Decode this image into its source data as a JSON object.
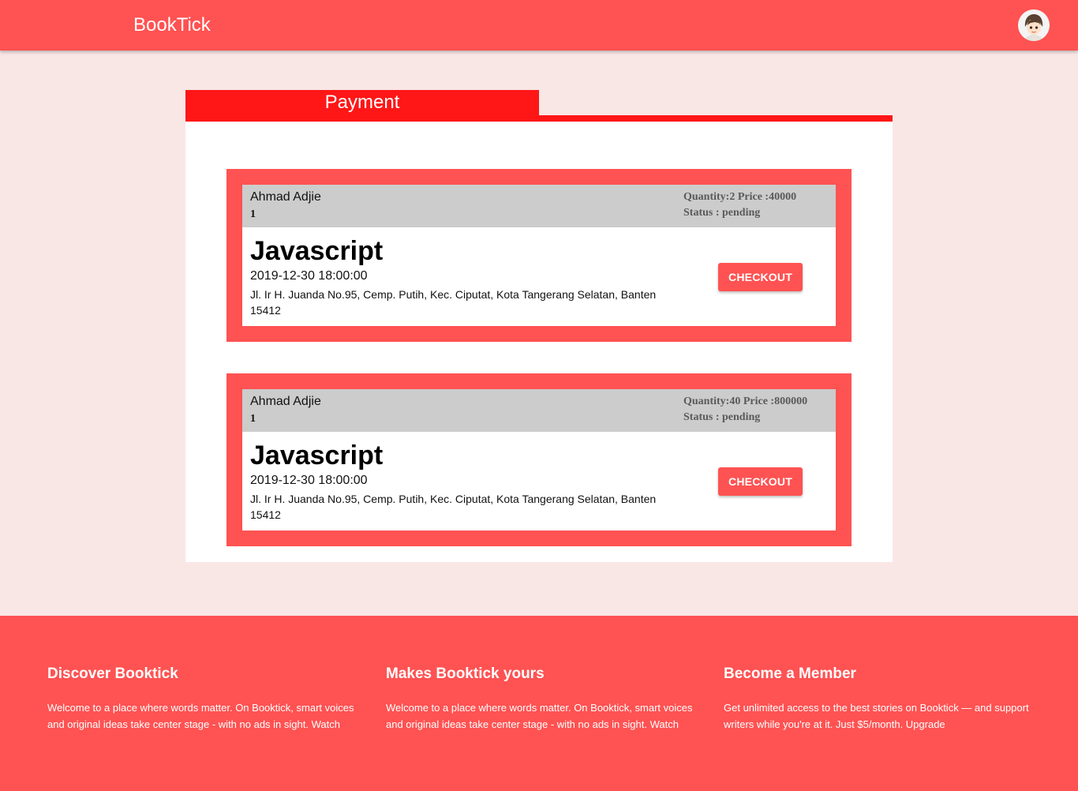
{
  "header": {
    "brand": "BookTick",
    "avatar_icon": "user-avatar-icon"
  },
  "payment": {
    "tab_label": "Payment",
    "orders": [
      {
        "buyer": "Ahmad Adjie",
        "ticket_id": "1",
        "quantity_price": "Quantity:2 Price :40000",
        "status": "Status : pending",
        "event_title": "Javascript",
        "event_date": "2019-12-30 18:00:00",
        "event_address": "Jl. Ir H. Juanda No.95, Cemp. Putih, Kec. Ciputat, Kota Tangerang Selatan, Banten 15412",
        "button_label": "CHECKOUT"
      },
      {
        "buyer": "Ahmad Adjie",
        "ticket_id": "1",
        "quantity_price": "Quantity:40 Price :800000",
        "status": "Status : pending",
        "event_title": "Javascript",
        "event_date": "2019-12-30 18:00:00",
        "event_address": "Jl. Ir H. Juanda No.95, Cemp. Putih, Kec. Ciputat, Kota Tangerang Selatan, Banten 15412",
        "button_label": "CHECKOUT"
      }
    ]
  },
  "footer": {
    "columns": [
      {
        "title": "Discover Booktick",
        "text": "Welcome to a place where words matter. On Booktick, smart voices and original ideas take center stage - with no ads in sight. Watch"
      },
      {
        "title": "Makes Booktick yours",
        "text": "Welcome to a place where words matter. On Booktick, smart voices and original ideas take center stage - with no ads in sight. Watch"
      },
      {
        "title": "Become a Member",
        "text": "Get unlimited access to the best stories on Booktick — and support writers while you're at it. Just $5/month. Upgrade"
      }
    ]
  },
  "colors": {
    "brand": "#ff5252",
    "tab_red": "#ff1616",
    "page_bg": "#f9e7e6",
    "order_head_bg": "#cccccc"
  }
}
